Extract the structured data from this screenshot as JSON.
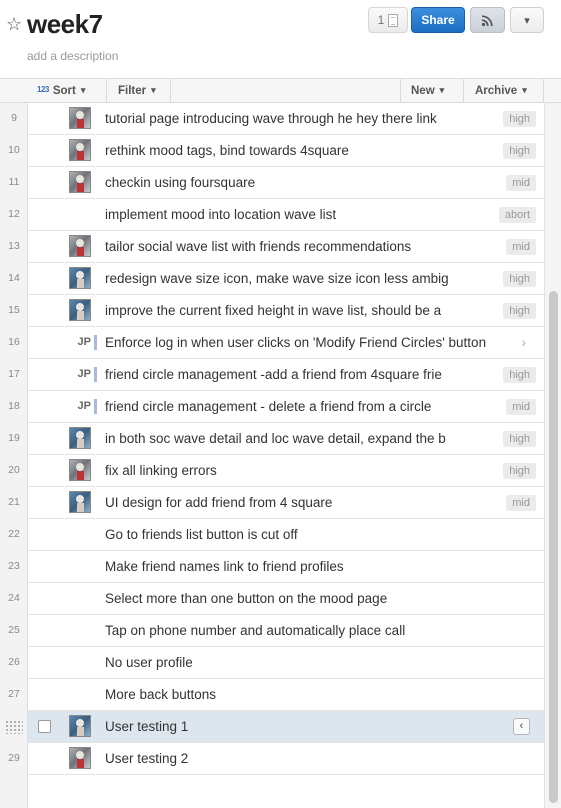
{
  "header": {
    "title": "week7",
    "description_placeholder": "add a description",
    "count": "1",
    "share_label": "Share"
  },
  "toolbar": {
    "sort_icon": "123",
    "sort_label": "Sort",
    "filter_label": "Filter",
    "new_label": "New",
    "archive_label": "Archive"
  },
  "rows": [
    {
      "num": "9",
      "text": "tutorial page introducing wave through he hey there link",
      "tag": "high",
      "avatar": "photo"
    },
    {
      "num": "10",
      "text": "rethink mood tags, bind towards 4square",
      "tag": "high",
      "avatar": "photo"
    },
    {
      "num": "11",
      "text": "checkin using foursquare",
      "tag": "mid",
      "avatar": "photo"
    },
    {
      "num": "12",
      "text": "implement mood into location wave list",
      "tag": "abort",
      "avatar": ""
    },
    {
      "num": "13",
      "text": "tailor social wave list with friends recommendations",
      "tag": "mid",
      "avatar": "photo"
    },
    {
      "num": "14",
      "text": "redesign wave size icon, make wave size icon less ambig",
      "tag": "high",
      "avatar": "color"
    },
    {
      "num": "15",
      "text": "improve the current fixed height in wave list, should be a",
      "tag": "high",
      "avatar": "color"
    },
    {
      "num": "16",
      "text": "Enforce log in when user clicks on 'Modify Friend Circles' button",
      "tag": "",
      "avatar": "JP"
    },
    {
      "num": "17",
      "text": "friend circle management -add a friend from 4square frie",
      "tag": "high",
      "avatar": "JP"
    },
    {
      "num": "18",
      "text": "friend circle management - delete a friend from a circle",
      "tag": "mid",
      "avatar": "JP"
    },
    {
      "num": "19",
      "text": "in both soc wave detail and loc wave detail, expand the b",
      "tag": "high",
      "avatar": "color"
    },
    {
      "num": "20",
      "text": "fix all linking errors",
      "tag": "high",
      "avatar": "photo"
    },
    {
      "num": "21",
      "text": "UI design for add friend from 4 square",
      "tag": "mid",
      "avatar": "color"
    },
    {
      "num": "22",
      "text": "Go to friends list button is cut off",
      "tag": "",
      "avatar": ""
    },
    {
      "num": "23",
      "text": "Make friend names link to friend profiles",
      "tag": "",
      "avatar": ""
    },
    {
      "num": "24",
      "text": "Select more than one button on the mood page",
      "tag": "",
      "avatar": ""
    },
    {
      "num": "25",
      "text": "Tap on phone number and automatically place call",
      "tag": "",
      "avatar": ""
    },
    {
      "num": "26",
      "text": "No user profile",
      "tag": "",
      "avatar": ""
    },
    {
      "num": "27",
      "text": "More back buttons",
      "tag": "",
      "avatar": ""
    },
    {
      "num": "",
      "text": "User testing 1",
      "tag": "",
      "avatar": "color"
    },
    {
      "num": "29",
      "text": "User testing 2",
      "tag": "",
      "avatar": "photo"
    }
  ]
}
